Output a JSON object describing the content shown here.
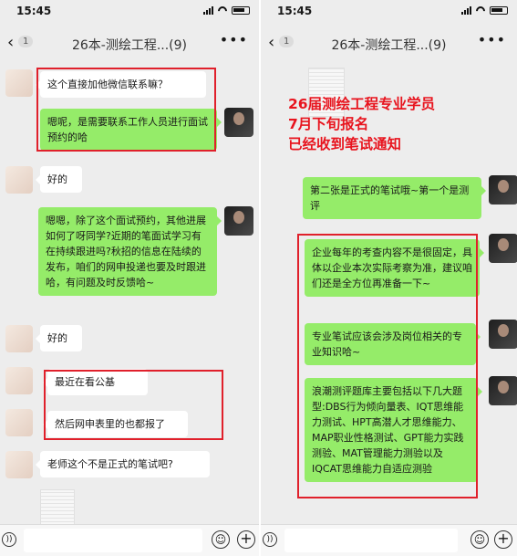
{
  "left": {
    "status_time": "15:45",
    "back_badge": "1",
    "title": "26本-测绘工程...(9)",
    "messages": [
      {
        "text": "这个直接加他微信联系嘛？"
      },
      {
        "text": "嗯呢，是需要联系工作人员进行面试预约的哈"
      },
      {
        "text": "好的"
      },
      {
        "text": "嗯嗯，除了这个面试预约，其他进展如何了呀同学?近期的笔面试学习有在持续跟进吗?秋招的信息在陆续的发布，咱们的网申投递也要及时跟进哈，有问题及时反馈哈~"
      },
      {
        "text": "好的"
      },
      {
        "text": "最近在看公基"
      },
      {
        "text": "然后网申表里的也都报了"
      },
      {
        "text": "老师这个不是正式的笔试吧?"
      }
    ]
  },
  "right": {
    "status_time": "15:45",
    "back_badge": "1",
    "title": "26本-测绘工程...(9)",
    "notice_lines": [
      "26届测绘工程专业学员",
      "7月下旬报名",
      "已经收到笔试通知"
    ],
    "messages": [
      {
        "text": "第二张是正式的笔试哦~第一个是测评"
      },
      {
        "text": "企业每年的考查内容不是很固定，具体以企业本次实际考察为准，建议咱们还是全方位再准备一下~"
      },
      {
        "text": "专业笔试应该会涉及岗位相关的专业知识哈~"
      },
      {
        "text": "浪潮测评题库主要包括以下几大题型:DBS行为倾向量表、IQT思维能力测试、HPT高潜人才思维能力、MAP职业性格测试、GPT能力实践测验、MAT管理能力测验以及IQCAT思维能力自适应测验"
      }
    ]
  },
  "colors": {
    "bubble_green": "#95ec69",
    "annotation_red": "#e0202b",
    "notice_red": "#e8141e"
  }
}
